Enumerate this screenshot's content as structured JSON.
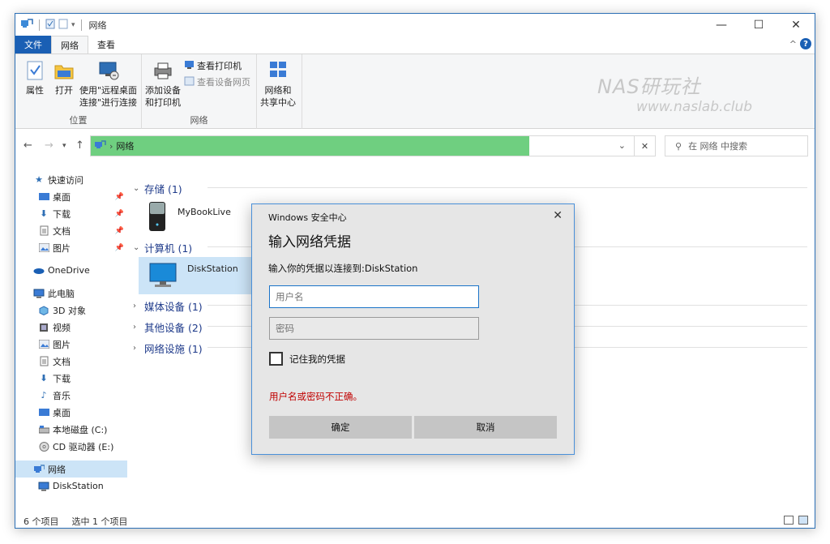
{
  "window": {
    "title": "网络",
    "controls": {
      "minimize": "—",
      "maximize": "☐",
      "close": "✕"
    }
  },
  "ribbon": {
    "tabs": [
      "文件",
      "网络",
      "查看"
    ],
    "groups": {
      "location": {
        "label": "位置",
        "buttons": {
          "properties": "属性",
          "open": "打开",
          "remote": "使用\"远程桌面\n连接\"进行连接"
        }
      },
      "network": {
        "label": "网络",
        "add_device": "添加设备\n和打印机",
        "view_printers": "查看打印机",
        "view_device_page": "查看设备网页",
        "sharing_center": "网络和\n共享中心"
      }
    }
  },
  "watermark": {
    "line1": "NAS研玩社",
    "line2": "www.naslab.club"
  },
  "address": {
    "location": "网络",
    "search_placeholder": "在 网络 中搜索"
  },
  "sidebar": {
    "quick_access": "快速访问",
    "quick_items": [
      "桌面",
      "下载",
      "文档",
      "图片"
    ],
    "onedrive": "OneDrive",
    "this_pc": "此电脑",
    "pc_items": [
      "3D 对象",
      "视频",
      "图片",
      "文档",
      "下载",
      "音乐",
      "桌面",
      "本地磁盘 (C:)",
      "CD 驱动器 (E:)"
    ],
    "network": "网络",
    "network_items": [
      "DiskStation"
    ]
  },
  "content": {
    "groups": [
      {
        "label": "存储 (1)",
        "items": [
          "MyBookLive"
        ]
      },
      {
        "label": "计算机 (1)",
        "items": [
          "DiskStation"
        ]
      },
      {
        "label": "媒体设备 (1)"
      },
      {
        "label": "其他设备 (2)"
      },
      {
        "label": "网络设施 (1)"
      }
    ]
  },
  "status": {
    "count": "6 个项目",
    "selected": "选中 1 个项目"
  },
  "dialog": {
    "title": "Windows 安全中心",
    "heading": "输入网络凭据",
    "subtitle": "输入你的凭据以连接到:DiskStation",
    "username_placeholder": "用户名",
    "password_placeholder": "密码",
    "remember": "记住我的凭据",
    "error": "用户名或密码不正确。",
    "ok": "确定",
    "cancel": "取消"
  },
  "colors": {
    "accent": "#1a5fb4",
    "address_fill": "#6fcf80",
    "error": "#c00000",
    "selection": "#cce4f7"
  }
}
